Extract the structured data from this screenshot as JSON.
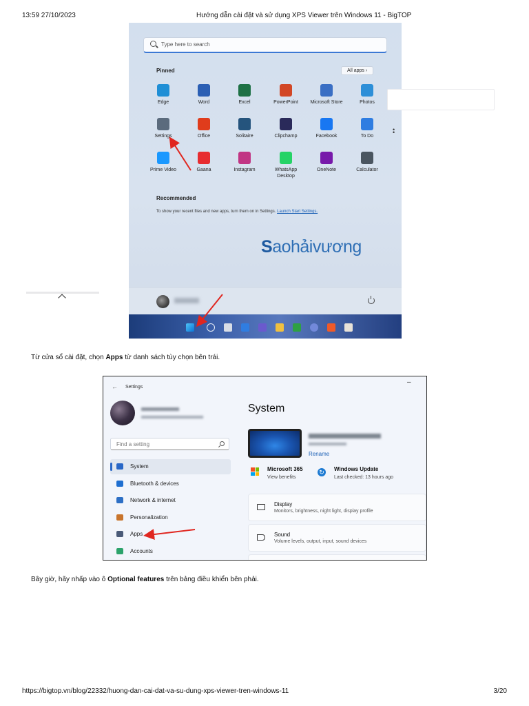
{
  "header": {
    "datetime": "13:59 27/10/2023",
    "title": "Hướng dẫn cài đặt và sử dụng XPS Viewer trên Windows 11 - BigTOP"
  },
  "start_menu": {
    "search_placeholder": "Type here to search",
    "pinned_label": "Pinned",
    "all_apps_label": "All apps  ›",
    "apps": [
      {
        "label": "Edge",
        "icon": "edge-icon",
        "color": "#1f8fd6"
      },
      {
        "label": "Word",
        "icon": "word-icon",
        "color": "#2b5fb4"
      },
      {
        "label": "Excel",
        "icon": "excel-icon",
        "color": "#1e7145"
      },
      {
        "label": "PowerPoint",
        "icon": "powerpoint-icon",
        "color": "#d24726"
      },
      {
        "label": "Microsoft Store",
        "icon": "store-icon",
        "color": "#3a6fc4"
      },
      {
        "label": "Photos",
        "icon": "photos-icon",
        "color": "#2d8fd8"
      },
      {
        "label": "Settings",
        "icon": "gear-icon",
        "color": "#5b6b7d"
      },
      {
        "label": "Office",
        "icon": "office-icon",
        "color": "#e03c1c"
      },
      {
        "label": "Solitaire",
        "icon": "solitaire-icon",
        "color": "#25547d"
      },
      {
        "label": "Clipchamp",
        "icon": "clipchamp-icon",
        "color": "#2a2a5a"
      },
      {
        "label": "Facebook",
        "icon": "facebook-icon",
        "color": "#1877f2"
      },
      {
        "label": "To Do",
        "icon": "todo-icon",
        "color": "#2f7de1"
      },
      {
        "label": "Prime Video",
        "icon": "prime-video-icon",
        "color": "#1a98ff"
      },
      {
        "label": "Gaana",
        "icon": "gaana-icon",
        "color": "#e72c30"
      },
      {
        "label": "Instagram",
        "icon": "instagram-icon",
        "color": "#c13584"
      },
      {
        "label": "WhatsApp Desktop",
        "icon": "whatsapp-icon",
        "color": "#25d366"
      },
      {
        "label": "OneNote",
        "icon": "onenote-icon",
        "color": "#7719aa"
      },
      {
        "label": "Calculator",
        "icon": "calculator-icon",
        "color": "#4a5560"
      }
    ],
    "recommended_label": "Recommended",
    "recommended_text": "To show your recent files and new apps, turn them on in Settings.",
    "recommended_link": "Launch Start Settings.",
    "watermark": "Saohảivương"
  },
  "instruction_1": {
    "before": "Từ cửa sổ cài đặt, chọn ",
    "bold": "Apps",
    "after": " từ danh sách tùy chọn bên trái."
  },
  "settings": {
    "window_title": "Settings",
    "search_placeholder": "Find a setting",
    "nav": [
      {
        "label": "System",
        "icon": "system-icon",
        "color": "#2867c7"
      },
      {
        "label": "Bluetooth & devices",
        "icon": "bluetooth-icon",
        "color": "#1f6fd0"
      },
      {
        "label": "Network & internet",
        "icon": "wifi-icon",
        "color": "#2d6fc5"
      },
      {
        "label": "Personalization",
        "icon": "brush-icon",
        "color": "#c8742c"
      },
      {
        "label": "Apps",
        "icon": "apps-icon",
        "color": "#4a5a78"
      },
      {
        "label": "Accounts",
        "icon": "accounts-icon",
        "color": "#2ca36b"
      }
    ],
    "page_title": "System",
    "rename_label": "Rename",
    "m365_title": "Microsoft 365",
    "m365_sub": "View benefits",
    "wu_title": "Windows Update",
    "wu_sub": "Last checked: 13 hours ago",
    "cards": [
      {
        "title": "Display",
        "sub": "Monitors, brightness, night light, display profile",
        "icon": "display-icon"
      },
      {
        "title": "Sound",
        "sub": "Volume levels, output, input, sound devices",
        "icon": "sound-icon"
      }
    ]
  },
  "instruction_2": {
    "before": "Bây giờ, hãy nhấp vào ô ",
    "bold": "Optional features",
    "after": " trên bảng điều khiển bên phải."
  },
  "footer": {
    "url": "https://bigtop.vn/blog/22332/huong-dan-cai-dat-va-su-dung-xps-viewer-tren-windows-11",
    "page": "3/20"
  },
  "colors": {
    "annotation_arrow": "#e0261f",
    "link": "#1a5fb4"
  }
}
